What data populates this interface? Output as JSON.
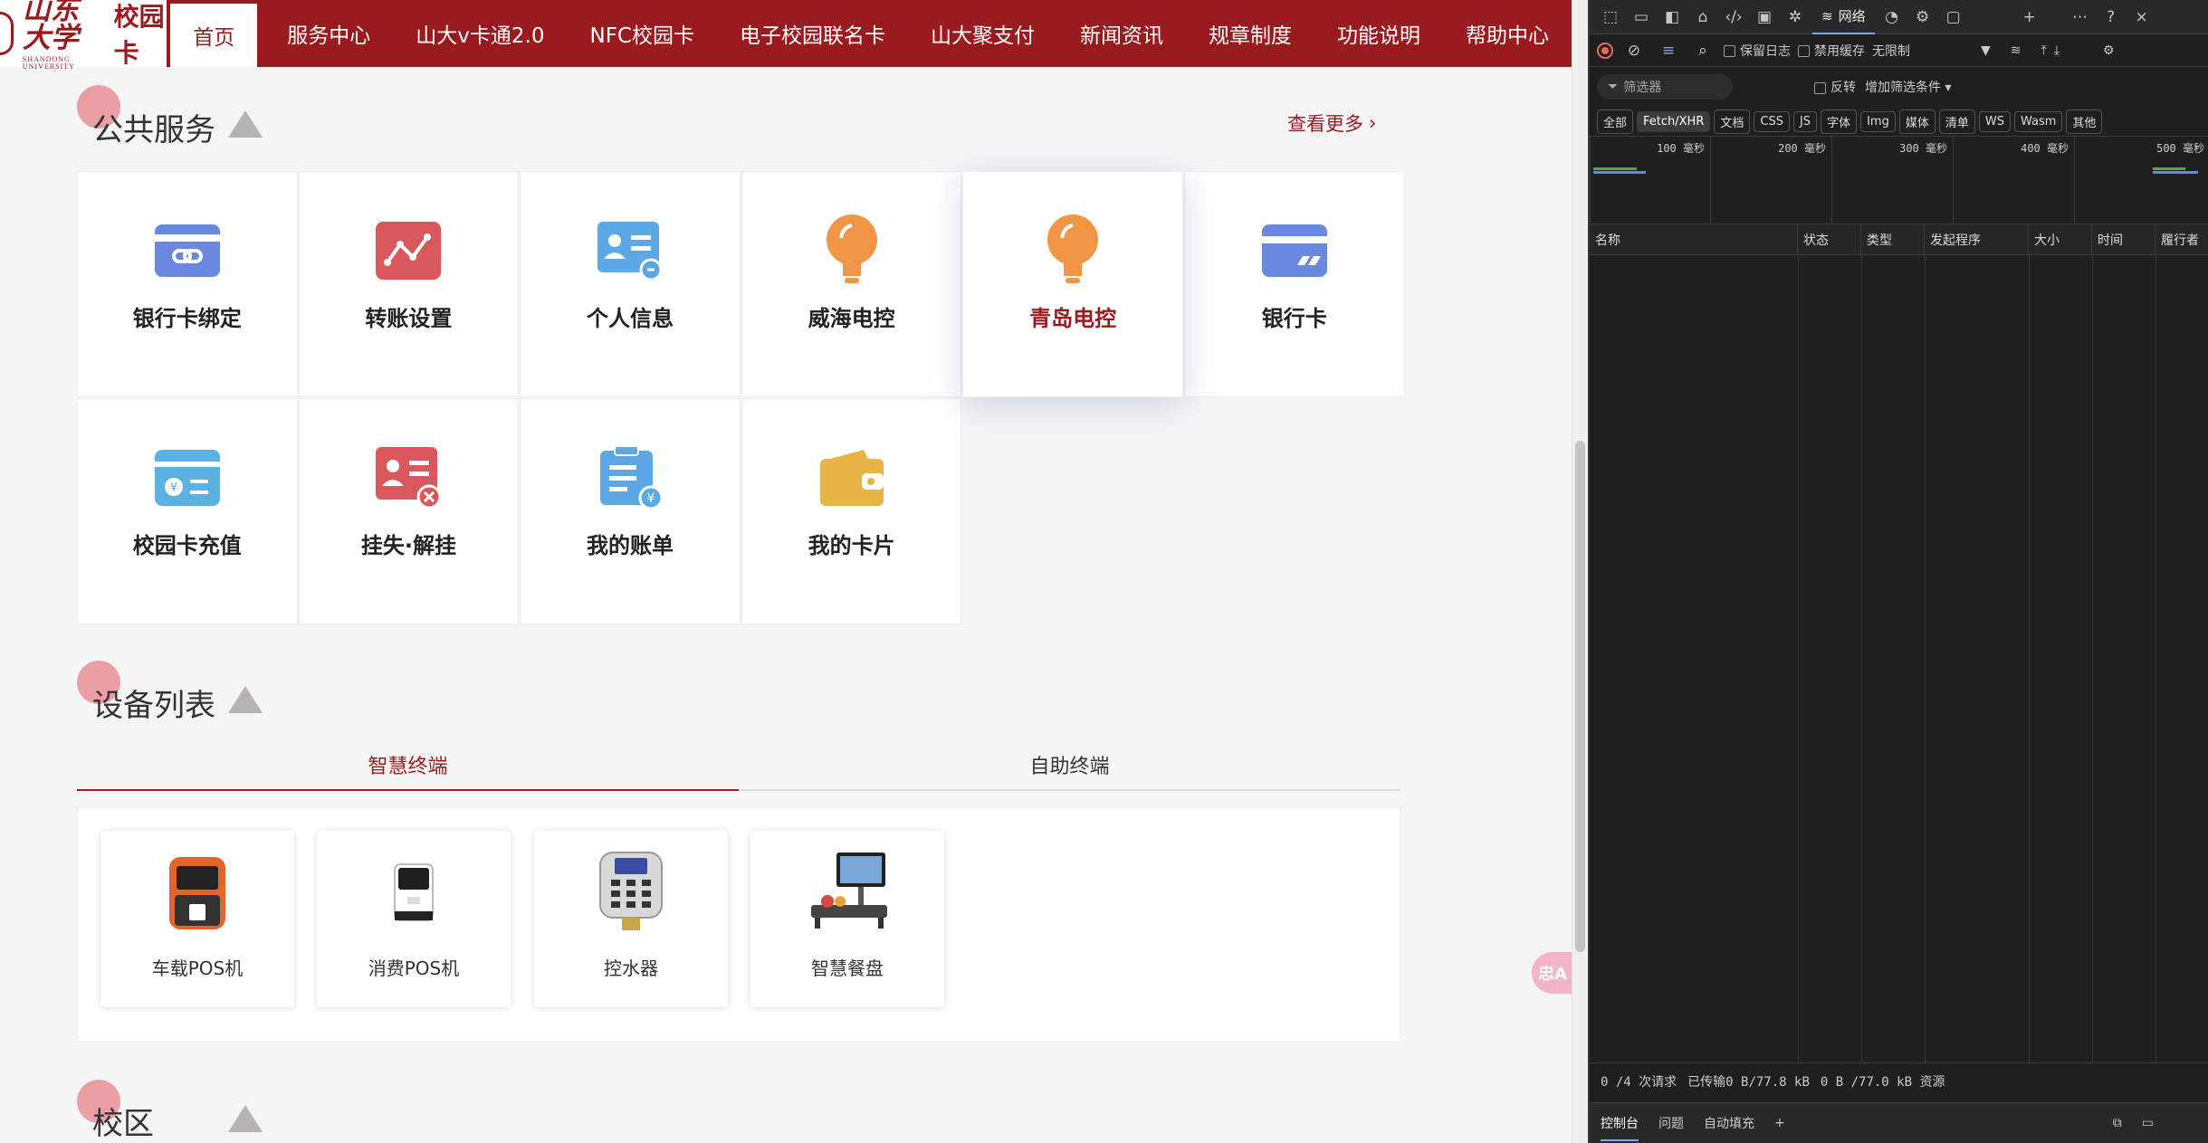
{
  "nav": {
    "logo_text": "山东大学",
    "logo_en": "SHANDONG UNIVERSITY",
    "logo_sub": "校园卡",
    "items": [
      {
        "label": "首页"
      },
      {
        "label": "服务中心"
      },
      {
        "label": "山大v卡通2.0"
      },
      {
        "label": "NFC校园卡"
      },
      {
        "label": "电子校园联名卡"
      },
      {
        "label": "山大聚支付"
      },
      {
        "label": "新闻资讯"
      },
      {
        "label": "规章制度"
      },
      {
        "label": "功能说明"
      },
      {
        "label": "帮助中心"
      }
    ]
  },
  "public_services": {
    "title": "公共服务",
    "more": "查看更多",
    "items": [
      {
        "label": "银行卡绑定",
        "icon": "card-link-icon",
        "color": "#6b88e0"
      },
      {
        "label": "转账设置",
        "icon": "transfer-chart-icon",
        "color": "#d9585c"
      },
      {
        "label": "个人信息",
        "icon": "id-card-icon",
        "color": "#5ba8e4"
      },
      {
        "label": "威海电控",
        "icon": "lightbulb-icon",
        "color": "#f29544"
      },
      {
        "label": "青岛电控",
        "icon": "lightbulb-icon",
        "color": "#f29544"
      },
      {
        "label": "银行卡",
        "icon": "bank-card-icon",
        "color": "#6b88e0"
      },
      {
        "label": "校园卡充值",
        "icon": "recharge-card-icon",
        "color": "#5bb1e0"
      },
      {
        "label": "挂失·解挂",
        "icon": "report-loss-icon",
        "color": "#d9585c"
      },
      {
        "label": "我的账单",
        "icon": "bill-icon",
        "color": "#5ba8e4"
      },
      {
        "label": "我的卡片",
        "icon": "wallet-icon",
        "color": "#e8b545"
      }
    ]
  },
  "devices": {
    "title": "设备列表",
    "tabs": [
      {
        "label": "智慧终端"
      },
      {
        "label": "自助终端"
      }
    ],
    "items": [
      {
        "label": "车载POS机",
        "icon": "vehicle-pos-icon"
      },
      {
        "label": "消费POS机",
        "icon": "consumer-pos-icon"
      },
      {
        "label": "控水器",
        "icon": "water-controller-icon"
      },
      {
        "label": "智慧餐盘",
        "icon": "smart-tray-icon"
      }
    ]
  },
  "campus": {
    "title": "校区"
  },
  "translate": {
    "label": "忠A"
  },
  "devtools": {
    "network_tab": "网络",
    "preserve_log": "保留日志",
    "disable_cache": "禁用缓存",
    "throttle": "无限制",
    "filter_placeholder": "筛选器",
    "invert": "反转",
    "more_filters": "增加筛选条件",
    "types": [
      "全部",
      "Fetch/XHR",
      "文档",
      "CSS",
      "JS",
      "字体",
      "Img",
      "媒体",
      "清单",
      "WS",
      "Wasm",
      "其他"
    ],
    "ticks": [
      "100 毫秒",
      "200 毫秒",
      "300 毫秒",
      "400 毫秒",
      "500 毫秒"
    ],
    "columns": [
      "名称",
      "状态",
      "类型",
      "发起程序",
      "大小",
      "时间",
      "履行者"
    ],
    "status": {
      "requests": "0 /4 次请求",
      "transferred": "已传输0 B/77.8 kB",
      "resources": "0 B /77.0 kB 资源"
    },
    "drawer": [
      "控制台",
      "问题",
      "自动填充"
    ]
  }
}
